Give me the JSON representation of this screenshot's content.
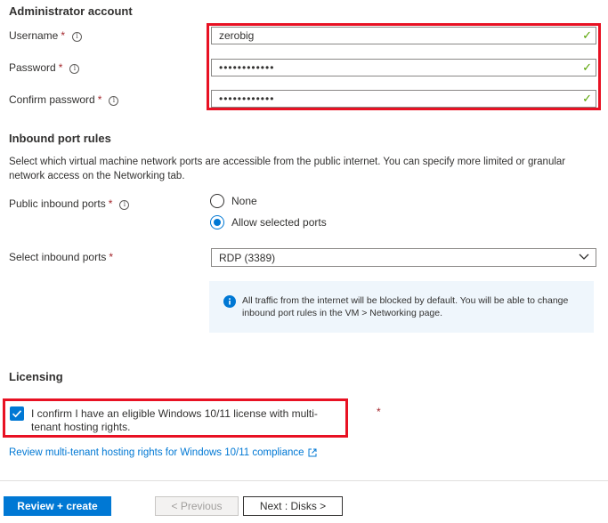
{
  "admin": {
    "title": "Administrator account",
    "username_label": "Username",
    "username_value": "zerobig",
    "password_label": "Password",
    "password_value": "••••••••••••",
    "confirm_label": "Confirm password",
    "confirm_value": "••••••••••••",
    "required_mark": "*"
  },
  "inbound": {
    "title": "Inbound port rules",
    "description": "Select which virtual machine network ports are accessible from the public internet. You can specify more limited or granular network access on the Networking tab.",
    "public_ports_label": "Public inbound ports",
    "option_none": "None",
    "option_allow": "Allow selected ports",
    "select_ports_label": "Select inbound ports",
    "select_ports_value": "RDP (3389)",
    "info_text": "All traffic from the internet will be blocked by default. You will be able to change inbound port rules in the VM > Networking page."
  },
  "licensing": {
    "title": "Licensing",
    "confirm_text": "I confirm I have an eligible Windows 10/11 license with multi-tenant hosting rights.",
    "review_link": "Review multi-tenant hosting rights for Windows 10/11 compliance"
  },
  "footer": {
    "review_create": "Review + create",
    "previous": "< Previous",
    "next": "Next : Disks >"
  },
  "colors": {
    "accent": "#0078d4",
    "valid": "#57a300",
    "highlight": "#e81123"
  }
}
